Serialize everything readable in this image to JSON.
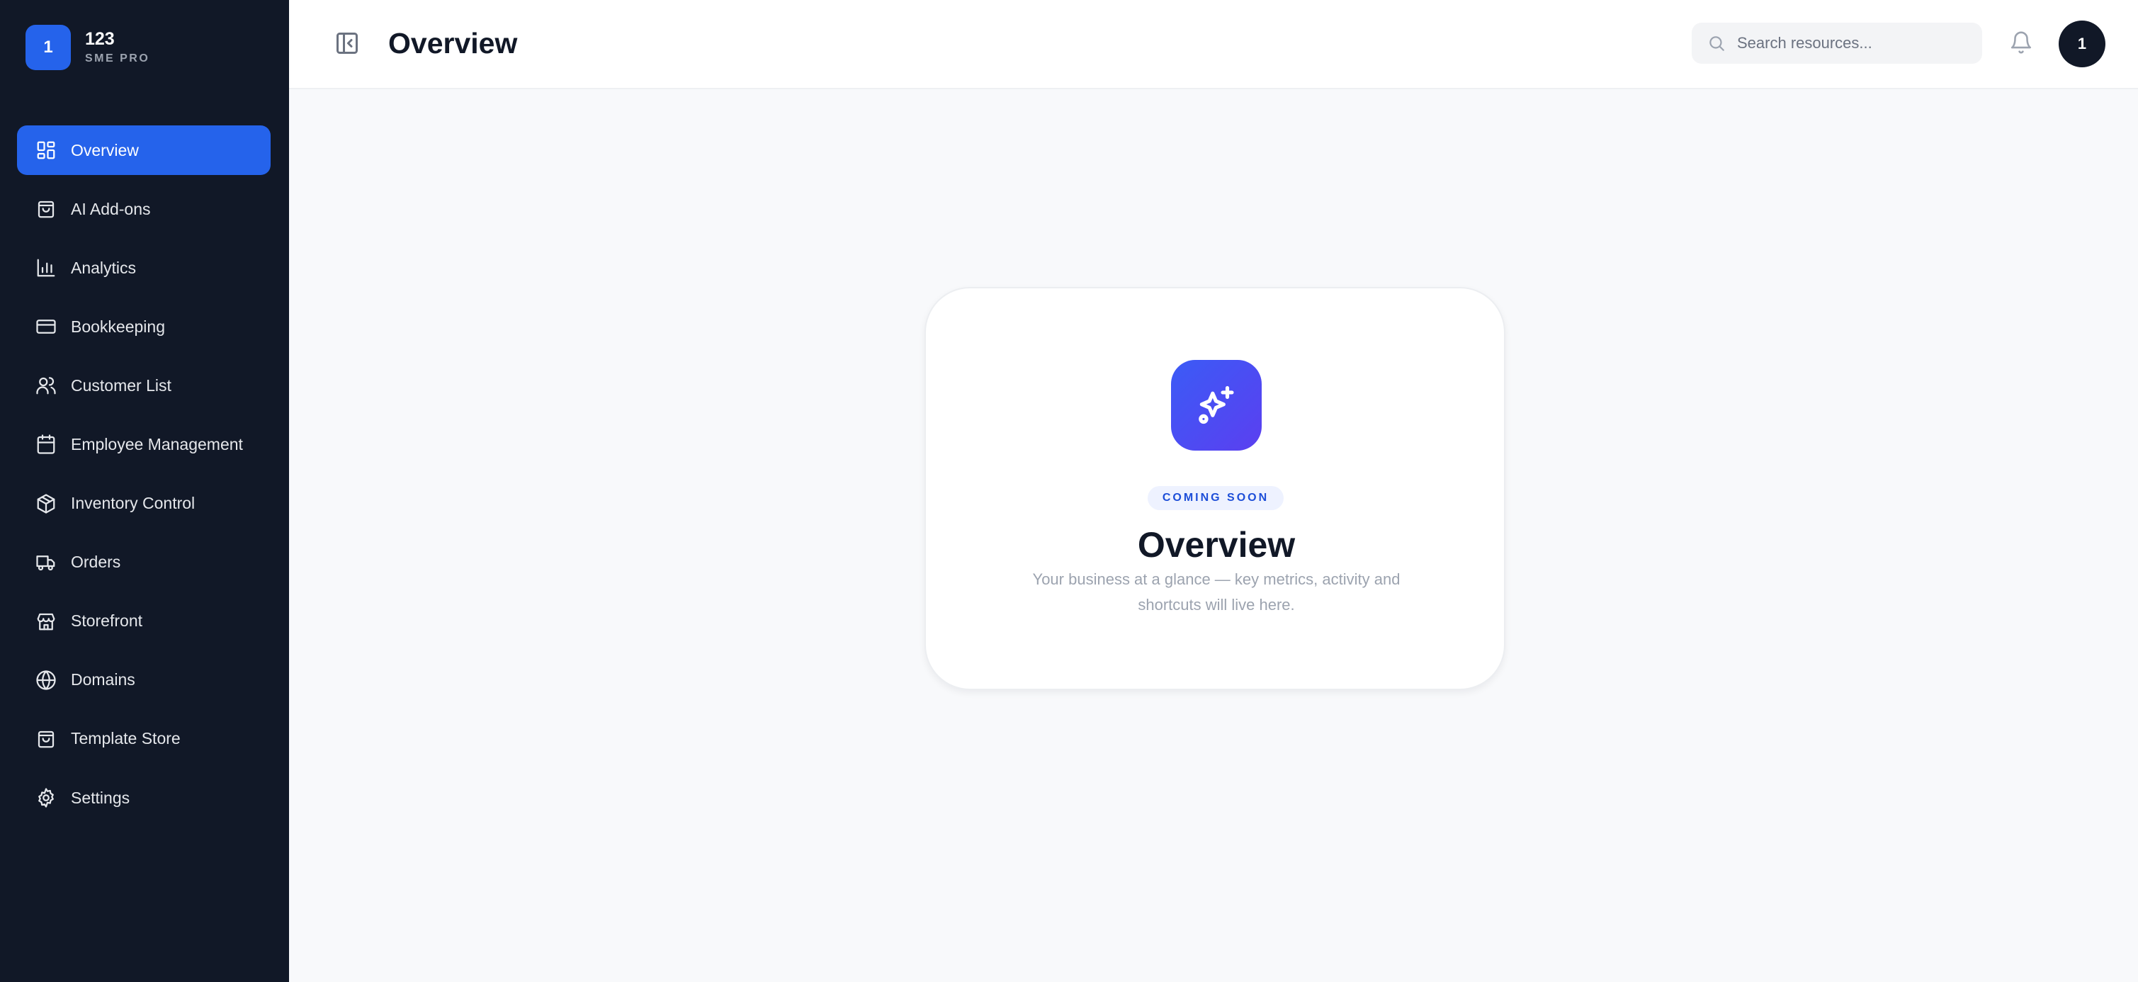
{
  "brand": {
    "logo_text": "1",
    "name": "123",
    "subtitle": "SME PRO"
  },
  "sidebar": {
    "items": [
      {
        "label": "Overview",
        "icon": "dashboard-icon",
        "active": true
      },
      {
        "label": "AI Add-ons",
        "icon": "shopping-bag-icon"
      },
      {
        "label": "Analytics",
        "icon": "bar-chart-icon"
      },
      {
        "label": "Bookkeeping",
        "icon": "credit-card-icon"
      },
      {
        "label": "Customer List",
        "icon": "users-icon"
      },
      {
        "label": "Employee Management",
        "icon": "calendar-icon"
      },
      {
        "label": "Inventory Control",
        "icon": "package-icon"
      },
      {
        "label": "Orders",
        "icon": "truck-icon"
      },
      {
        "label": "Storefront",
        "icon": "store-icon"
      },
      {
        "label": "Domains",
        "icon": "globe-icon"
      },
      {
        "label": "Template Store",
        "icon": "shopping-bag-icon"
      },
      {
        "label": "Settings",
        "icon": "gear-icon"
      }
    ]
  },
  "header": {
    "title": "Overview",
    "search_placeholder": "Search resources...",
    "avatar_text": "1"
  },
  "card": {
    "badge": "COMING SOON",
    "title": "Overview",
    "description": "Your business at a glance — key metrics, activity and shortcuts will live here."
  },
  "colors": {
    "sidebar_bg": "#111827",
    "accent": "#2563eb",
    "page_bg": "#f8f9fb"
  }
}
